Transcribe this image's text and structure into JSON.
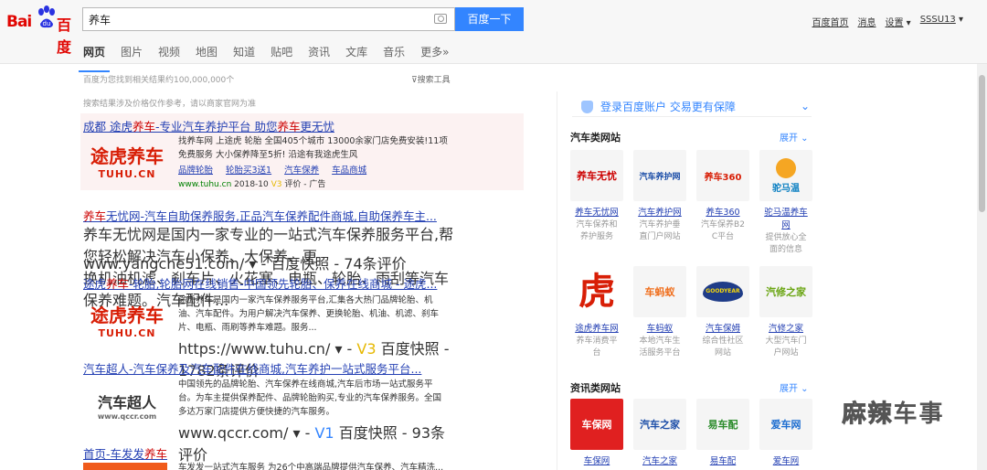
{
  "logo": {
    "bai": "Bai",
    "du": "百度"
  },
  "search": {
    "value": "养车",
    "button": "百度一下"
  },
  "topnav": [
    "百度首页",
    "消息",
    "设置",
    "SSSU13"
  ],
  "tabs": [
    "网页",
    "图片",
    "视频",
    "地图",
    "知道",
    "贴吧",
    "资讯",
    "文库",
    "音乐",
    "更多»"
  ],
  "result_count": "百度为您找到相关结果约100,000,000个",
  "search_tools": "搜索工具",
  "notice": "搜索结果涉及价格仅作参考，请以商家官网为准",
  "results": [
    {
      "title_pre": "成都 途虎",
      "title_hl": "养车",
      "title_mid": "-专业汽车养护平台 助您",
      "title_hl2": "养车",
      "title_post": "更无忧",
      "thumb_main": "途虎养车",
      "thumb_sub": "TUHU.CN",
      "desc1": "找养车网 上途虎 轮胎 全国405个城市 13000余家门店免费安装!11项",
      "desc2": "免费服务 大小保养降至5折! 沿途有我途虎生风",
      "sublinks": [
        "品牌轮胎",
        "轮胎买3送1",
        "汽车保养",
        "车品商城"
      ],
      "url": "www.tuhu.cn",
      "date": "2018-10",
      "v": "V3",
      "extra": "评价 - 广告"
    },
    {
      "title_pre": "",
      "title_hl": "养车",
      "title_mid": "无忧网-汽车自助保养服务,正品汽车保养配件商城,自助保养车主...",
      "title_hl2": "",
      "title_post": "",
      "desc1": "养车无忧网是国内一家专业的一站式汽车保养服务平台,帮您轻松解决汽车小保养、大保养、更",
      "desc2": "换机油机滤、刹车片、火花塞、电瓶、轮胎、雨刮等汽车保养难题。汽车配件...",
      "url": "www.yangche51.com/",
      "extra": "百度快照 - 74条评价"
    },
    {
      "title_pre": "途虎",
      "title_hl": "养车",
      "title_mid": "-轮胎,轮胎网在线销售-中国领先轮胎、保养在线商城 - 途虎...",
      "title_hl2": "",
      "title_post": "",
      "thumb_main": "途虎养车",
      "thumb_sub": "TUHU.CN",
      "desc1": "途虎养车是国内一家汽车保养服务平台,汇集各大热门品牌轮胎、机",
      "desc2": "油、汽车配件。为用户解决汽车保养、更换轮胎、机油、机滤、刹车",
      "desc3": "片、电瓶、雨刷等养车难题。服务...",
      "url": "https://www.tuhu.cn/",
      "v": "V3",
      "extra": "百度快照 - 1782条评价"
    },
    {
      "title_pre": "汽车超人-汽车保养及汽车配件在线商城,汽车养护一站式服务平台...",
      "title_hl": "",
      "title_mid": "",
      "title_hl2": "",
      "title_post": "",
      "thumb_main": "汽车超人",
      "thumb_sub": "www.qccr.com",
      "desc1": "中国领先的品牌轮胎、汽车保养在线商城,汽车后市场一站式服务平",
      "desc2": "台。为车主提供保养配件、品牌轮胎购买,专业的汽车保养服务。全国",
      "desc3": "多达万家门店提供方便快捷的汽车服务。",
      "url": "www.qccr.com/",
      "v": "V1",
      "extra": "百度快照 - 93条评价"
    },
    {
      "title_pre": "首页-车发发",
      "title_hl": "养车",
      "title_mid": "",
      "title_hl2": "",
      "title_post": "",
      "desc1": "车发发一站式汽车服务 为26个中高端品牌提供汽车保养、汽车精洗..."
    }
  ],
  "right": {
    "login": "登录百度账户  交易更有保障",
    "section1": "汽车类网站",
    "section2": "资讯类网站",
    "expand": "展开",
    "sites1": [
      {
        "logo": "养车无忧",
        "name": "养车无忧网",
        "d1": "汽车保养和",
        "d2": "养护服务"
      },
      {
        "logo": "汽车养护网",
        "name": "汽车养护网",
        "d1": "汽车养护垂",
        "d2": "直门户网站"
      },
      {
        "logo": "养车360",
        "name": "养车360",
        "d1": "汽车保养B2",
        "d2": "C平台"
      },
      {
        "logo": "驼马温",
        "name": "驼马温养车",
        "name2": "网",
        "d1": "提供放心全",
        "d2": "面的信息"
      }
    ],
    "sites2": [
      {
        "logo": "虎",
        "name": "途虎养车网",
        "d1": "养车消费平",
        "d2": "台"
      },
      {
        "logo": "车蚂蚁",
        "name": "车蚂蚁",
        "d1": "本地汽车生",
        "d2": "活服务平台"
      },
      {
        "logo": "GOODYEAR",
        "name": "汽车保姆",
        "d1": "综合性社区",
        "d2": "网站"
      },
      {
        "logo": "汽修之家",
        "name": "汽修之家",
        "d1": "大型汽车门",
        "d2": "户网站"
      }
    ],
    "sites3": [
      {
        "logo": "车保网",
        "name": "车保网"
      },
      {
        "logo": "汽车之家",
        "name": "汽车之家"
      },
      {
        "logo": "易车配",
        "name": "易车配"
      },
      {
        "logo": "爱车网",
        "name": "爱车网"
      }
    ]
  },
  "watermark": {
    "w1": "麻辣",
    "w2": "车事"
  }
}
